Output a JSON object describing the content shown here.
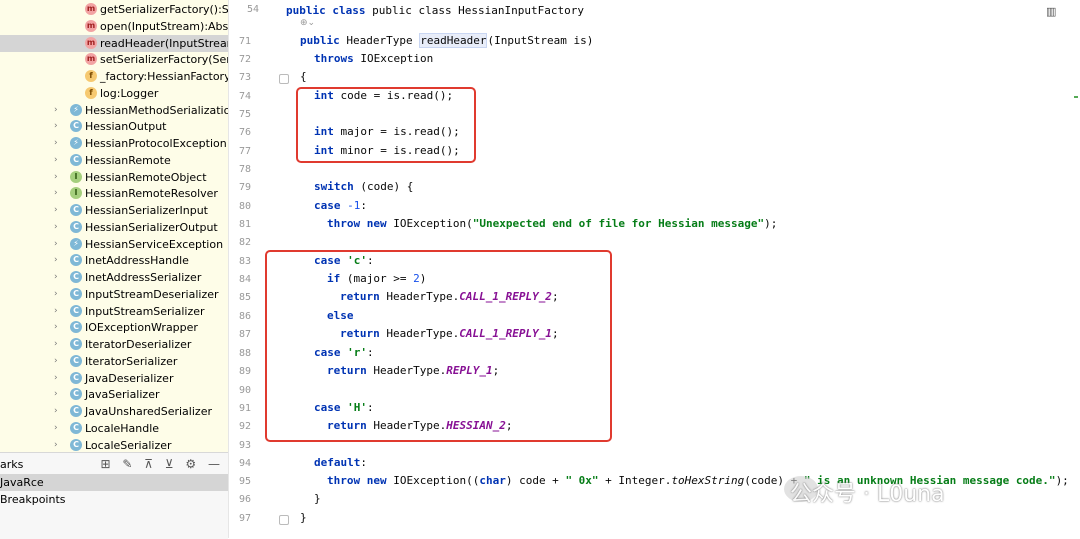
{
  "sidebar": {
    "items": [
      {
        "icon": "m",
        "label": "getSerializerFactory():Ser"
      },
      {
        "icon": "m",
        "label": "open(InputStream):Abstra"
      },
      {
        "icon": "m",
        "label": "readHeader(InputStream)"
      },
      {
        "icon": "m",
        "label": "setSerializerFactory(Seria"
      },
      {
        "icon": "f",
        "label": "_factory:HessianFactory"
      },
      {
        "icon": "f",
        "label": "log:Logger"
      },
      {
        "icon": "e",
        "label": "HessianMethodSerializationE"
      },
      {
        "icon": "c",
        "label": "HessianOutput"
      },
      {
        "icon": "e",
        "label": "HessianProtocolException"
      },
      {
        "icon": "c",
        "label": "HessianRemote"
      },
      {
        "icon": "i",
        "label": "HessianRemoteObject"
      },
      {
        "icon": "i",
        "label": "HessianRemoteResolver"
      },
      {
        "icon": "c",
        "label": "HessianSerializerInput"
      },
      {
        "icon": "c",
        "label": "HessianSerializerOutput"
      },
      {
        "icon": "e",
        "label": "HessianServiceException"
      },
      {
        "icon": "c",
        "label": "InetAddressHandle"
      },
      {
        "icon": "c",
        "label": "InetAddressSerializer"
      },
      {
        "icon": "c",
        "label": "InputStreamDeserializer"
      },
      {
        "icon": "c",
        "label": "InputStreamSerializer"
      },
      {
        "icon": "c",
        "label": "IOExceptionWrapper"
      },
      {
        "icon": "c",
        "label": "IteratorDeserializer"
      },
      {
        "icon": "c",
        "label": "IteratorSerializer"
      },
      {
        "icon": "c",
        "label": "JavaDeserializer"
      },
      {
        "icon": "c",
        "label": "JavaSerializer"
      },
      {
        "icon": "c",
        "label": "JavaUnsharedSerializer"
      },
      {
        "icon": "c",
        "label": "LocaleHandle"
      },
      {
        "icon": "c",
        "label": "LocaleSerializer"
      }
    ],
    "selected_index": 2
  },
  "bookmarks": {
    "header": "arks",
    "tools": "⊞ ✎  ⊼ ⊻  ⚙ —",
    "rows": [
      {
        "label": "JavaRce",
        "selected": true
      },
      {
        "label": "Breakpoints",
        "selected": false
      }
    ]
  },
  "editor": {
    "sticky_line": {
      "num": "54",
      "text": "public class HessianInputFactory"
    },
    "hint": "⊕⌄",
    "line_numbers": [
      "71",
      "72",
      "73",
      "74",
      "75",
      "76",
      "77",
      "78",
      "79",
      "80",
      "81",
      "82",
      "83",
      "84",
      "85",
      "86",
      "87",
      "88",
      "89",
      "90",
      "91",
      "92",
      "93",
      "94",
      "95",
      "96",
      "97"
    ],
    "code": {
      "l71a": "public ",
      "l71b": "HeaderType ",
      "l71c": "readHeader",
      "l71d": "(InputStream is)",
      "l72a": "throws ",
      "l72b": "IOException",
      "l73": "{",
      "l74a": "int ",
      "l74b": "code = is.read();",
      "l76a": "int ",
      "l76b": "major = is.read();",
      "l77a": "int ",
      "l77b": "minor = is.read();",
      "l79a": "switch ",
      "l79b": "(code) {",
      "l80a": "case ",
      "l80b": "-1",
      ":": ":",
      "l81a": "throw new ",
      "l81b": "IOException(",
      "l81c": "\"Unexpected end of file for Hessian message\"",
      "l81d": ");",
      "l83a": "case ",
      "l83b": "'c'",
      "l83c": ":",
      "l84a": "if ",
      "l84b": "(major >= ",
      "l84c": "2",
      "l84d": ")",
      "l85a": "return ",
      "l85b": "HeaderType.",
      "l85c": "CALL_1_REPLY_2",
      "l85d": ";",
      "l86": "else",
      "l87a": "return ",
      "l87b": "HeaderType.",
      "l87c": "CALL_1_REPLY_1",
      "l87d": ";",
      "l88a": "case ",
      "l88b": "'r'",
      "l88c": ":",
      "l89a": "return ",
      "l89b": "HeaderType.",
      "l89c": "REPLY_1",
      "l89d": ";",
      "l91a": "case ",
      "l91b": "'H'",
      "l91c": ":",
      "l92a": "return ",
      "l92b": "HeaderType.",
      "l92c": "HESSIAN_2",
      "l92d": ";",
      "l94a": "default",
      "l95a": "throw new ",
      "l95b": "IOException((",
      "l95c": "char",
      "l95d": ") code + ",
      "l95e": "\" 0x\"",
      "l95f": " + Integer.",
      "l95g": "toHexString",
      "l95h": "(code) + ",
      "l95i": "\" is an unknown Hessian message code.\"",
      "l95j": ");",
      "l96": "}",
      "l97": "}"
    }
  },
  "watermark": "公众号 · L0una",
  "colors": {
    "highlight_box": "#e03a2f",
    "keyword": "#0033b3",
    "string": "#067d17",
    "constant": "#871094",
    "sidebar_bg": "#fefde8"
  }
}
